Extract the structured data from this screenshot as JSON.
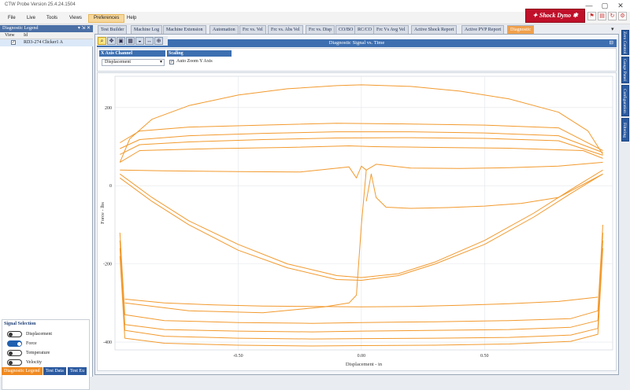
{
  "window": {
    "title": "CTW Probe Version 25.4.24.1504",
    "min": "—",
    "max": "▢",
    "close": "✕"
  },
  "menu": [
    "File",
    "Live",
    "Tools",
    "Views",
    "Preferences",
    "Help"
  ],
  "menu_active": "Preferences",
  "brand_button": {
    "label": "Shock Dyno",
    "icon": "dyno-logo-icon"
  },
  "legend_panel": {
    "title": "Diagnostic Legend",
    "controls": "▾ ⇲ ✕",
    "col_view": "View",
    "col_id": "Id",
    "rows": [
      {
        "checked": "✓",
        "id": "RD3-274 Clicker1 A"
      }
    ]
  },
  "signal_selection": {
    "title": "Signal Selection",
    "items": [
      {
        "label": "Displacement",
        "on": false
      },
      {
        "label": "Force",
        "on": true
      },
      {
        "label": "Temperature",
        "on": false
      },
      {
        "label": "Velocity",
        "on": false
      }
    ]
  },
  "bottom_tabs": [
    "Diagnostic Legend",
    "Test Data",
    "Test Eu"
  ],
  "tabs": [
    "Test Builder",
    "Machine Log",
    "Machine Extension",
    "Automation",
    "Frc vs. Vel",
    "Frc vs. Abs Vel",
    "Frc vs. Disp",
    "CO/BO",
    "RC/CO",
    "Frc Vs Avg Vel",
    "Active Shock Report",
    "Active PVP Report",
    "Diagnostic"
  ],
  "active_tab": "Diagnostic",
  "collapse_glyph": "▾",
  "panel_title": "Diagnostic Signal vs. Time",
  "panel_pin": "⊟",
  "x_axis_channel": {
    "label": "X Axis Channel",
    "value": "Displacement",
    "caret": "▾"
  },
  "scaling": {
    "label": "Scaling",
    "checked": "✓",
    "option": "Auto Zoom Y Axis"
  },
  "right_rail": [
    "Zero Control",
    "Gauge Panel",
    "Configuration",
    "Filtering"
  ],
  "colors": {
    "accent": "#f29a2e",
    "header_blue": "#3d6fb0",
    "tab_blue": "#2b5aa0"
  },
  "chart_data": {
    "type": "line",
    "title": "",
    "xlabel": "Displacement - in",
    "ylabel": "Force - lbs",
    "xlim": [
      -1.0,
      1.02
    ],
    "ylim": [
      -420,
      280
    ],
    "xticks": [
      -0.5,
      0.0,
      0.5
    ],
    "xtick_labels": [
      "-0.50",
      "0.00",
      "0.50"
    ],
    "yticks": [
      200,
      0,
      -200,
      -400
    ],
    "ytick_labels": [
      "200",
      "0",
      "-200",
      "-400"
    ],
    "grid": true,
    "series": [
      {
        "x": [
          -0.98,
          -0.94,
          -0.85,
          -0.7,
          -0.5,
          -0.3,
          -0.1,
          0.0,
          0.2,
          0.4,
          0.6,
          0.8,
          0.92,
          0.98
        ],
        "y": [
          60,
          120,
          170,
          205,
          232,
          248,
          256,
          258,
          254,
          242,
          222,
          188,
          140,
          80
        ]
      },
      {
        "x": [
          -0.98,
          -0.9,
          -0.7,
          -0.4,
          -0.1,
          0.2,
          0.5,
          0.8,
          0.98
        ],
        "y": [
          110,
          140,
          150,
          155,
          160,
          158,
          155,
          148,
          90
        ]
      },
      {
        "x": [
          -0.98,
          -0.9,
          -0.7,
          -0.4,
          -0.1,
          0.2,
          0.5,
          0.8,
          0.98
        ],
        "y": [
          95,
          118,
          128,
          134,
          138,
          138,
          135,
          128,
          85
        ]
      },
      {
        "x": [
          -0.98,
          -0.9,
          -0.7,
          -0.4,
          -0.1,
          0.2,
          0.5,
          0.8,
          0.98
        ],
        "y": [
          80,
          105,
          112,
          118,
          122,
          123,
          121,
          115,
          78
        ]
      },
      {
        "x": [
          -0.98,
          -0.9,
          -0.6,
          -0.3,
          -0.05,
          0.05,
          0.3,
          0.6,
          0.9,
          0.98
        ],
        "y": [
          60,
          90,
          95,
          98,
          102,
          100,
          98,
          96,
          90,
          70
        ]
      },
      {
        "x": [
          -0.98,
          -0.8,
          -0.5,
          -0.25,
          -0.05,
          -0.02,
          0.0,
          0.02,
          0.06,
          0.2,
          0.4,
          0.6,
          0.8,
          0.98
        ],
        "y": [
          40,
          38,
          36,
          35,
          48,
          20,
          50,
          40,
          55,
          45,
          44,
          46,
          50,
          60
        ]
      },
      {
        "x": [
          0.02,
          0.04,
          0.06,
          0.1,
          0.2,
          0.35,
          0.5,
          0.65,
          0.8,
          0.98
        ],
        "y": [
          -40,
          30,
          -30,
          -55,
          -58,
          -56,
          -52,
          -45,
          -30,
          30
        ]
      },
      {
        "x": [
          -0.98,
          -0.85,
          -0.7,
          -0.5,
          -0.3,
          -0.1,
          0.0,
          0.15,
          0.3,
          0.5,
          0.7,
          0.85,
          0.98
        ],
        "y": [
          30,
          -30,
          -90,
          -150,
          -200,
          -230,
          -235,
          -225,
          -195,
          -140,
          -70,
          -10,
          40
        ]
      },
      {
        "x": [
          -0.98,
          -0.85,
          -0.7,
          -0.5,
          -0.3,
          -0.1,
          0.0,
          0.15,
          0.3,
          0.5,
          0.7,
          0.85,
          0.98
        ],
        "y": [
          20,
          -40,
          -100,
          -165,
          -210,
          -240,
          -242,
          -230,
          -200,
          -150,
          -80,
          -20,
          30
        ]
      },
      {
        "x": [
          -0.98,
          -0.96,
          -0.8,
          -0.5,
          -0.2,
          0.0,
          0.3,
          0.6,
          0.85,
          0.96,
          0.98
        ],
        "y": [
          -120,
          -330,
          -345,
          -350,
          -352,
          -350,
          -348,
          -345,
          -340,
          -320,
          -100
        ]
      },
      {
        "x": [
          -0.98,
          -0.96,
          -0.8,
          -0.5,
          -0.2,
          0.0,
          0.3,
          0.6,
          0.85,
          0.96,
          0.98
        ],
        "y": [
          -140,
          -355,
          -368,
          -372,
          -374,
          -372,
          -370,
          -368,
          -362,
          -345,
          -120
        ]
      },
      {
        "x": [
          -0.98,
          -0.96,
          -0.8,
          -0.5,
          -0.2,
          0.0,
          0.3,
          0.6,
          0.85,
          0.96,
          0.98
        ],
        "y": [
          -160,
          -370,
          -385,
          -390,
          -392,
          -391,
          -390,
          -388,
          -382,
          -365,
          -140
        ]
      },
      {
        "x": [
          -0.98,
          -0.96,
          -0.8,
          -0.5,
          -0.2,
          0.0,
          0.3,
          0.6,
          0.85,
          0.96,
          0.98
        ],
        "y": [
          -180,
          -390,
          -403,
          -408,
          -410,
          -409,
          -408,
          -405,
          -398,
          -380,
          -160
        ]
      },
      {
        "x": [
          -0.96,
          -0.7,
          -0.4,
          -0.15,
          -0.05,
          -0.02,
          0.0,
          0.02
        ],
        "y": [
          -300,
          -320,
          -325,
          -310,
          -300,
          -280,
          -100,
          40
        ]
      },
      {
        "x": [
          -0.96,
          -0.8,
          -0.6,
          -0.4,
          -0.2,
          0.0,
          0.2,
          0.4,
          0.6,
          0.8,
          0.96
        ],
        "y": [
          -290,
          -300,
          -305,
          -308,
          -309,
          -310,
          -309,
          -306,
          -302,
          -296,
          -285
        ]
      }
    ]
  }
}
